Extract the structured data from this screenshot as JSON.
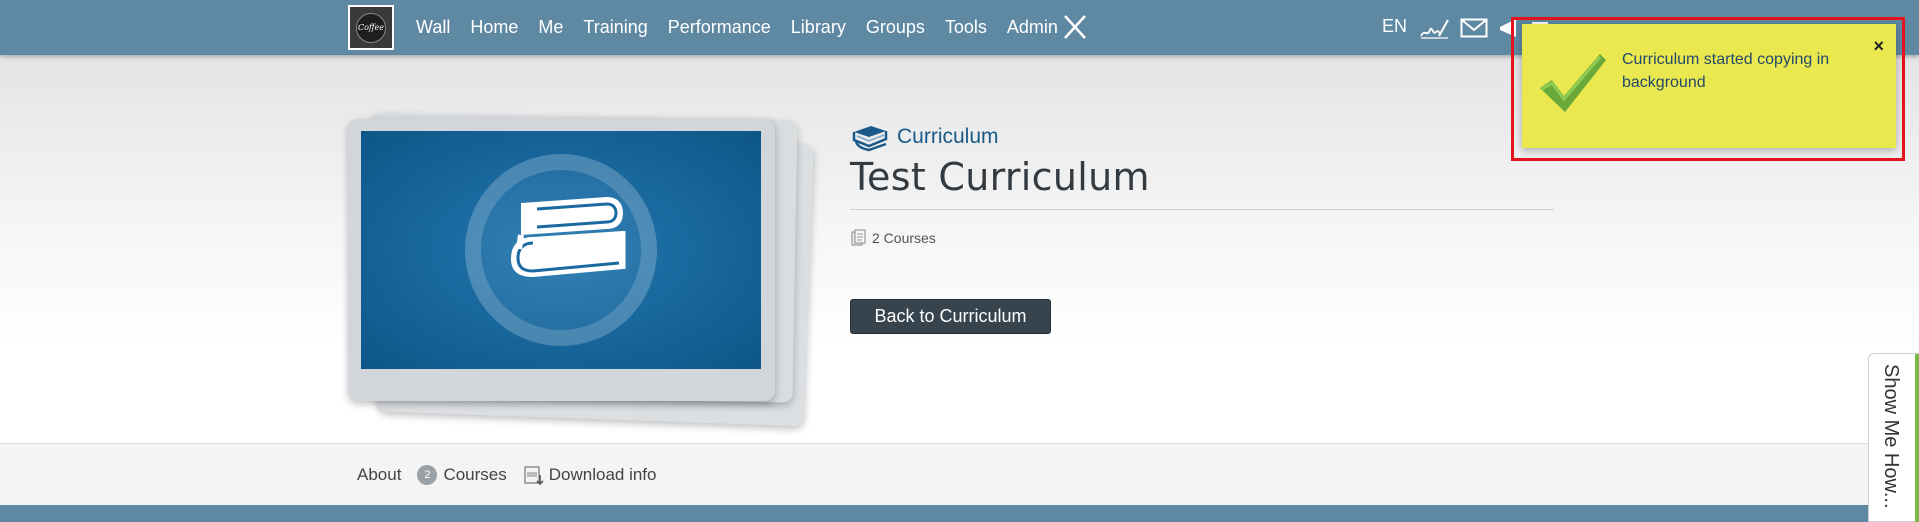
{
  "nav": {
    "logo_text": "Coffee",
    "items": [
      "Wall",
      "Home",
      "Me",
      "Training",
      "Performance",
      "Library",
      "Groups",
      "Tools",
      "Admin"
    ],
    "language": "EN",
    "icons": [
      "signature-icon",
      "mail-icon",
      "megaphone-icon",
      "gift-icon"
    ],
    "colors": {
      "bar": "#5f88a3"
    }
  },
  "content": {
    "type_label": "Curriculum",
    "title": "Test Curriculum",
    "courses_count_label": "2 Courses",
    "back_button": "Back to Curriculum"
  },
  "tabs": {
    "about": "About",
    "courses_badge": "2",
    "courses": "Courses",
    "download": "Download info"
  },
  "toast": {
    "message": "Curriculum started copying in background",
    "close": "×",
    "color": "#e9e94f"
  },
  "side_help": {
    "label": "Show Me How..."
  }
}
